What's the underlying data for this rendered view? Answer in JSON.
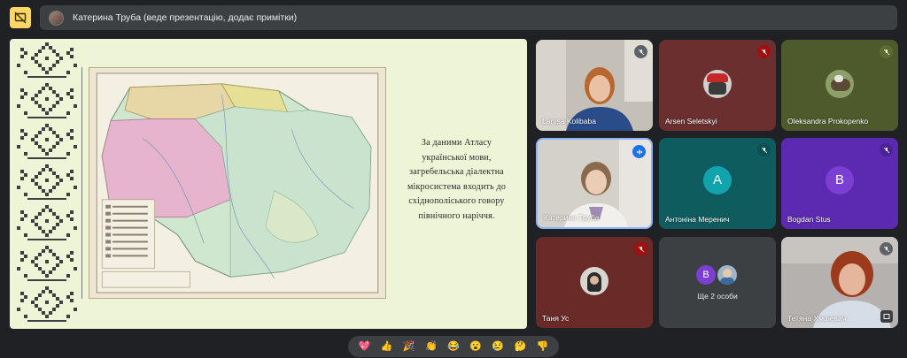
{
  "top_bar": {
    "presenter_text": "Катерина Труба (веде презентацію, додає примітки)"
  },
  "slide": {
    "text_lines": [
      "За даними Атласу",
      "української мови,",
      "загребельська діалектна",
      "мікросистема  входить до",
      "східнополіського говору",
      "північного наріччя."
    ]
  },
  "participants": [
    {
      "name": "Larysa Kolibaba",
      "bg": "#b8b4ae",
      "mic_color": "#5f6368",
      "type": "video"
    },
    {
      "name": "Arsen Seletskyi",
      "bg": "#6b2f2f",
      "mic_color": "#a50e0e",
      "type": "avatar"
    },
    {
      "name": "Oleksandra Prokopenko",
      "bg": "#4e5a2c",
      "mic_color": "#5f6b2e",
      "type": "avatar"
    },
    {
      "name": "Катерина Труба",
      "bg": "#c9c5bf",
      "mic_color": "#1a73e8",
      "type": "video"
    },
    {
      "name": "Антоніна Меренич",
      "bg": "#0f5c5f",
      "mic_color": "#0b4f52",
      "letter": "А",
      "letter_bg": "#12a4ad",
      "type": "letter"
    },
    {
      "name": "Bogdan Stus",
      "bg": "#5b2ab0",
      "mic_color": "#4a2394",
      "letter": "B",
      "letter_bg": "#7b3fd3",
      "type": "letter"
    },
    {
      "name": "Таня Ус",
      "bg": "#6a2a28",
      "mic_color": "#a50e0e",
      "type": "avatar"
    },
    {
      "name": "Ще 2 особи",
      "bg": "#3c4043",
      "type": "group",
      "letter": "B",
      "letter_bg": "#7b3fd3"
    },
    {
      "name": "Тетяна Хмілевич",
      "bg": "#a8a4a2",
      "mic_color": "#5f6368",
      "type": "video"
    }
  ],
  "reactions": [
    "💖",
    "👍",
    "🎉",
    "👏",
    "😂",
    "😮",
    "😢",
    "🤔",
    "👎"
  ]
}
